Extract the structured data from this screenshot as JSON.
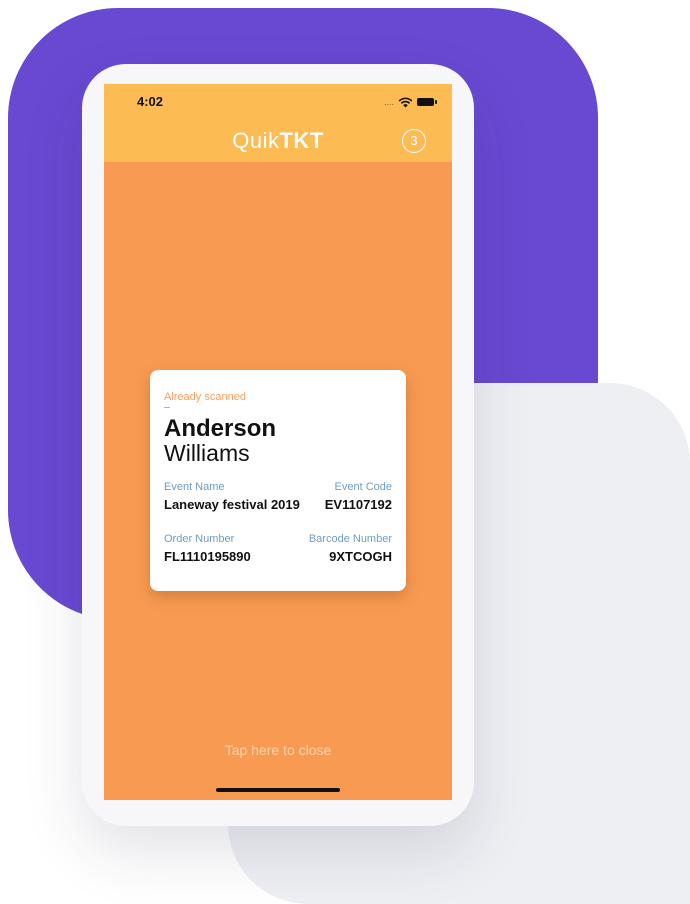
{
  "status_bar": {
    "time": "4:02",
    "signal": "....",
    "icons": [
      "wifi-icon",
      "battery-icon"
    ]
  },
  "header": {
    "title_light": "Quik",
    "title_bold": "TKT",
    "count": "3",
    "color": "#FDBC53"
  },
  "screen_color": "#F89A52",
  "ticket": {
    "status": "Already scanned",
    "first_name": "Anderson",
    "last_name": "Williams",
    "event_name_label": "Event Name",
    "event_name": "Laneway festival 2019",
    "event_code_label": "Event Code",
    "event_code": "EV1107192",
    "order_number_label": "Order Number",
    "order_number": "FL1110195890",
    "barcode_label": "Barcode Number",
    "barcode": "9XTCOGH"
  },
  "close_label": "Tap here to close",
  "colors": {
    "accent_purple": "#6849D2",
    "label_blue": "#6F9DC0",
    "status_orange": "#F6A060"
  }
}
